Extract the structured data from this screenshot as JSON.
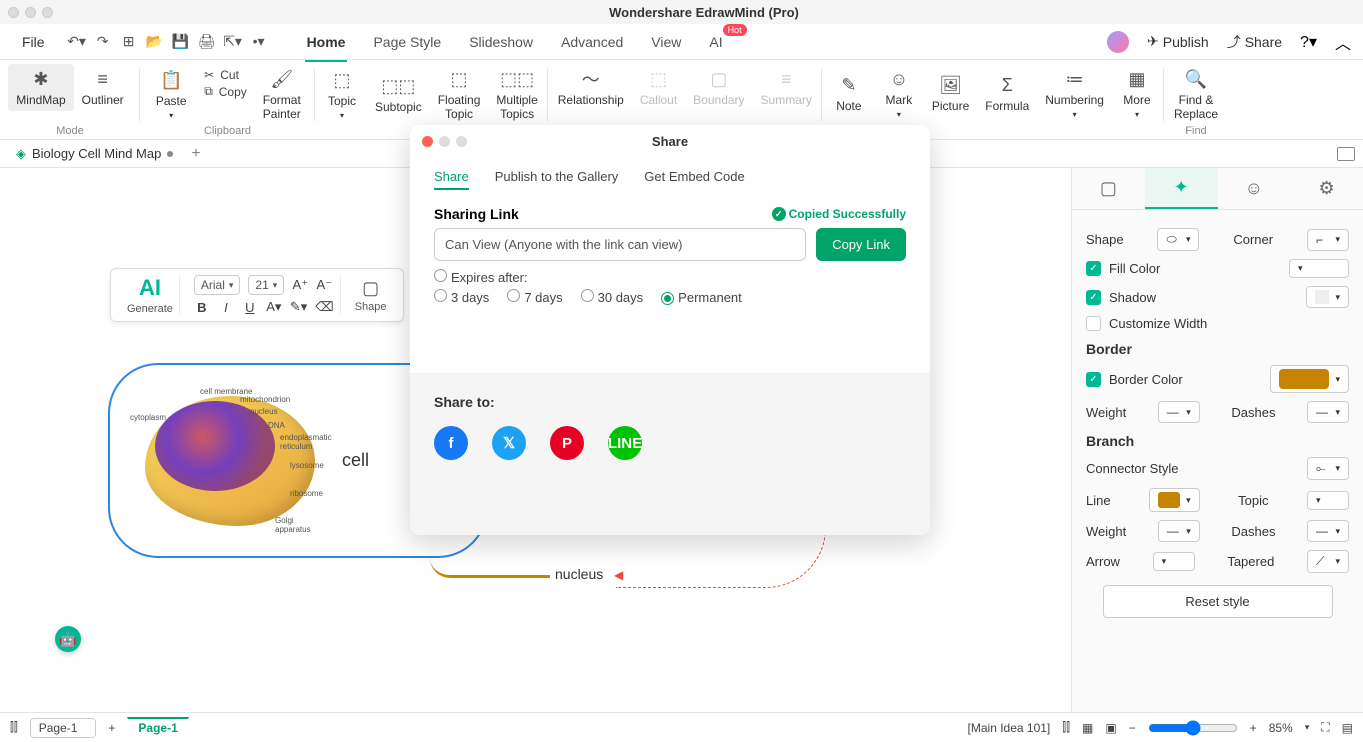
{
  "app_title": "Wondershare EdrawMind (Pro)",
  "menubar": {
    "file": "File",
    "publish": "Publish",
    "share": "Share"
  },
  "tabs": [
    "Home",
    "Page Style",
    "Slideshow",
    "Advanced",
    "View",
    "AI"
  ],
  "active_tab": "Home",
  "ribbon": {
    "mode_label": "Mode",
    "mindmap": "MindMap",
    "outliner": "Outliner",
    "paste": "Paste",
    "cut": "Cut",
    "copy": "Copy",
    "format_painter": "Format\nPainter",
    "clipboard_label": "Clipboard",
    "topic": "Topic",
    "subtopic": "Subtopic",
    "floating": "Floating\nTopic",
    "multiple": "Multiple\nTopics",
    "relationship": "Relationship",
    "callout": "Callout",
    "boundary": "Boundary",
    "summary": "Summary",
    "note": "Note",
    "mark": "Mark",
    "picture": "Picture",
    "formula": "Formula",
    "numbering": "Numbering",
    "more": "More",
    "find_replace": "Find &\nReplace",
    "find": "Find"
  },
  "document_tab": "Biology Cell Mind Map",
  "float_toolbar": {
    "generate": "Generate",
    "font": "Arial",
    "size": "21",
    "shape": "Shape"
  },
  "canvas": {
    "main_label": "cell",
    "branch_label": "nucleus",
    "cell_labels": [
      "cell membrane",
      "mitochondrion",
      "cytoplasm",
      "nucleus",
      "DNA",
      "endoplasmatic reticulum",
      "lysosome",
      "ribosome",
      "Golgi apparatus"
    ]
  },
  "right_panel": {
    "shape": "Shape",
    "corner": "Corner",
    "fill": "Fill Color",
    "shadow": "Shadow",
    "custom_width": "Customize Width",
    "border_h": "Border",
    "border_color": "Border Color",
    "weight": "Weight",
    "dashes": "Dashes",
    "branch_h": "Branch",
    "connector": "Connector Style",
    "line": "Line",
    "topic": "Topic",
    "arrow": "Arrow",
    "tapered": "Tapered",
    "reset": "Reset style",
    "border_color_hex": "#c68400",
    "line_color_hex": "#c68400"
  },
  "statusbar": {
    "page_sel": "Page-1",
    "page_tab": "Page-1",
    "main_idea": "[Main Idea 101]",
    "zoom": "85%"
  },
  "modal": {
    "title": "Share",
    "tabs": [
      "Share",
      "Publish to the Gallery",
      "Get Embed Code"
    ],
    "active_tab": "Share",
    "heading": "Sharing Link",
    "copied": "Copied Successfully",
    "link_text": "Can View (Anyone with the link can view)",
    "copy_btn": "Copy Link",
    "expires": "Expires after:",
    "options": [
      "3 days",
      "7 days",
      "30 days",
      "Permanent"
    ],
    "selected": "Permanent",
    "share_to": "Share to:"
  }
}
